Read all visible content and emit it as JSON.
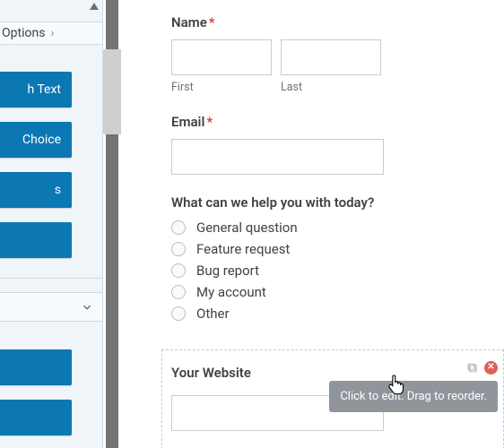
{
  "left": {
    "options_label": "Options",
    "btn1": "h Text",
    "btn2": "Choice",
    "btn3": "s"
  },
  "form": {
    "name": {
      "label": "Name",
      "first": "First",
      "last": "Last"
    },
    "email": {
      "label": "Email"
    },
    "help": {
      "label": "What can we help you with today?",
      "options": [
        "General question",
        "Feature request",
        "Bug report",
        "My account",
        "Other"
      ]
    },
    "website": {
      "label": "Your Website"
    }
  },
  "tooltip": "Click to edit. Drag to reorder."
}
